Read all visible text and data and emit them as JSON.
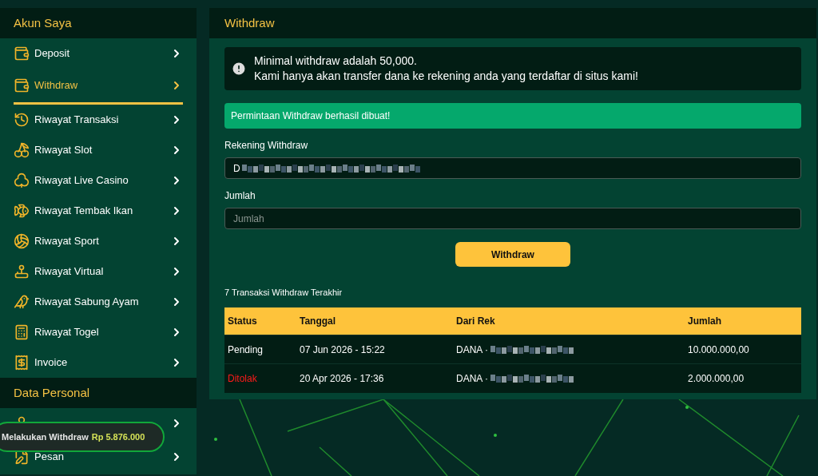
{
  "sidebar": {
    "sections": [
      {
        "title": "Akun Saya",
        "items": [
          {
            "label": "Deposit",
            "selected": false
          },
          {
            "label": "Withdraw",
            "selected": true
          },
          {
            "label": "Riwayat Transaksi",
            "selected": false
          },
          {
            "label": "Riwayat Slot",
            "selected": false
          },
          {
            "label": "Riwayat Live Casino",
            "selected": false
          },
          {
            "label": "Riwayat Tembak Ikan",
            "selected": false
          },
          {
            "label": "Riwayat Sport",
            "selected": false
          },
          {
            "label": "Riwayat Virtual",
            "selected": false
          },
          {
            "label": "Riwayat Sabung Ayam",
            "selected": false
          },
          {
            "label": "Riwayat Togel",
            "selected": false
          },
          {
            "label": "Invoice",
            "selected": false
          }
        ]
      },
      {
        "title": "Data Personal",
        "items": [
          {
            "selected": false
          },
          {
            "label": "Pesan",
            "selected": false
          }
        ]
      }
    ]
  },
  "toast": {
    "text": "Melakukan Withdraw",
    "amount": "Rp 5.876.000"
  },
  "panel": {
    "title": "Withdraw",
    "notice": [
      "Minimal withdraw adalah 50,000.",
      "Kami hanya akan transfer dana ke rekening anda yang terdaftar di situs kami!"
    ],
    "success": "Permintaan Withdraw berhasil dibuat!",
    "fields": [
      {
        "label": "Rekening Withdraw",
        "value": "D"
      },
      {
        "label": "Jumlah",
        "placeholder": "Jumlah"
      }
    ],
    "button": "Withdraw",
    "history_title": "7 Transaksi Withdraw Terakhir",
    "table": {
      "columns": [
        "Status",
        "Tanggal",
        "Dari Rek",
        "Jumlah"
      ],
      "rows": [
        {
          "status": "Pending",
          "kind": "pending",
          "date": "07 Jun 2026 - 15:22",
          "account": "DANA ·",
          "amount": "10.000.000,00"
        },
        {
          "status": "Ditolak",
          "kind": "rejected",
          "date": "20 Apr 2026 - 17:36",
          "account": "DANA ·",
          "amount": "2.000.000,00"
        }
      ]
    }
  }
}
